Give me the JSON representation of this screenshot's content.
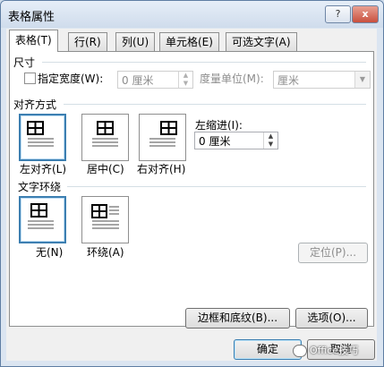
{
  "window": {
    "title": "表格属性",
    "help": "?",
    "close": "x"
  },
  "tabs": [
    "表格(T)",
    "行(R)",
    "列(U)",
    "单元格(E)",
    "可选文字(A)"
  ],
  "size": {
    "heading": "尺寸",
    "specify_width": "指定宽度(W):",
    "width_value": "0 厘米",
    "measure_label": "度量单位(M):",
    "measure_value": "厘米"
  },
  "alignment": {
    "heading": "对齐方式",
    "options": [
      "左对齐(L)",
      "居中(C)",
      "右对齐(H)"
    ],
    "selected": 0,
    "indent_label": "左缩进(I):",
    "indent_value": "0 厘米"
  },
  "wrapping": {
    "heading": "文字环绕",
    "options": [
      "无(N)",
      "环绕(A)"
    ],
    "selected": 0,
    "position_button": "定位(P)..."
  },
  "buttons": {
    "borders": "边框和底纹(B)...",
    "options": "选项(O)...",
    "ok": "确定",
    "cancel": "取消"
  },
  "watermark": "Office技巧",
  "colors": {
    "highlight": "#d9262b",
    "selection": "#3c7fb1"
  }
}
